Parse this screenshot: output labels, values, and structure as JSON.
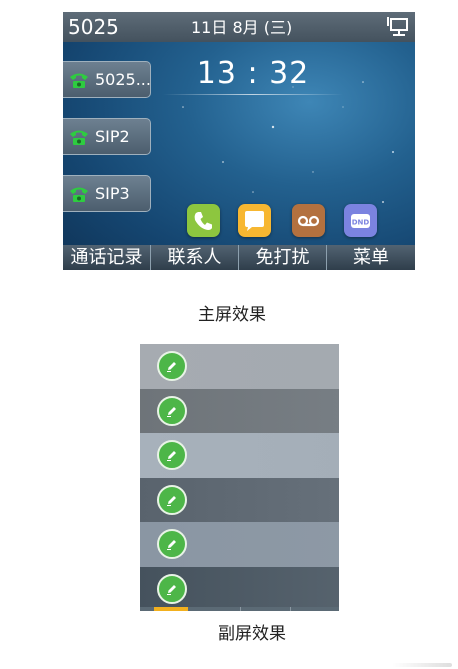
{
  "main_screen": {
    "status_bar": {
      "account": "5025",
      "date": "11日 8月 (三)",
      "network_icon": "network-icon"
    },
    "clock": "13 : 32",
    "line_keys": [
      {
        "label": "5025...",
        "icon": "phone-icon"
      },
      {
        "label": "SIP2",
        "icon": "phone-icon"
      },
      {
        "label": "SIP3",
        "icon": "phone-icon"
      }
    ],
    "apps": [
      {
        "icon": "phone-app-icon",
        "color": "#8dc63f"
      },
      {
        "icon": "message-app-icon",
        "color": "#f7b731"
      },
      {
        "icon": "voicemail-app-icon",
        "color": "#b3713f"
      },
      {
        "icon": "dnd-app-icon",
        "color": "#7b83e0",
        "text": "DND"
      }
    ],
    "soft_keys": [
      "通话记录",
      "联系人",
      "免打扰",
      "菜单"
    ]
  },
  "main_caption": "主屏效果",
  "sub_screen": {
    "rows": [
      {
        "icon": "edit-icon",
        "color": "#a6abb1"
      },
      {
        "icon": "edit-icon",
        "color": "#6e7479"
      },
      {
        "icon": "edit-icon",
        "color": "#a7b1bb"
      },
      {
        "icon": "edit-icon",
        "color": "#59636d"
      },
      {
        "icon": "edit-icon",
        "color": "#8a96a3"
      },
      {
        "icon": "edit-icon",
        "color": "#45525d"
      }
    ]
  },
  "sub_caption": "副屏效果"
}
